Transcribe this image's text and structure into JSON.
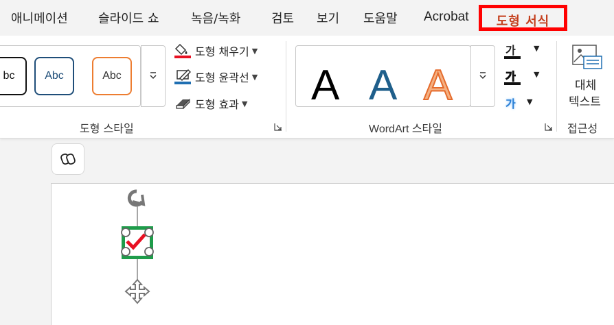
{
  "tabs": [
    {
      "label": "애니메이션"
    },
    {
      "label": "슬라이드 쇼"
    },
    {
      "label": "녹음/녹화"
    },
    {
      "label": "검토"
    },
    {
      "label": "보기"
    },
    {
      "label": "도움말"
    },
    {
      "label": "Acrobat"
    }
  ],
  "active_tab": {
    "label": "도형 서식"
  },
  "shape_styles": {
    "gallery": [
      {
        "text": "bc",
        "color": "#111111"
      },
      {
        "text": "Abc",
        "color": "#1f4e79"
      },
      {
        "text": "Abc",
        "color": "#ed7d31"
      }
    ],
    "commands": {
      "fill": "도형 채우기",
      "outline": "도형 윤곽선",
      "effects": "도형 효과"
    },
    "group_label": "도형 스타일"
  },
  "wordart": {
    "letters": [
      {
        "text": "A",
        "style": "black-fill"
      },
      {
        "text": "A",
        "style": "blue-fill"
      },
      {
        "text": "A",
        "style": "orange-outline"
      }
    ],
    "mini": {
      "text_fill": "가",
      "text_outline": "가",
      "text_effects": "가"
    },
    "group_label": "WordArt 스타일"
  },
  "accessibility": {
    "alt_text_line1": "대체",
    "alt_text_line2": "텍스트",
    "group_label": "접근성"
  },
  "colors": {
    "accent_red": "#ff0000",
    "active_tab_text": "#c43e1c",
    "fill_bar": "#e81123",
    "outline_bar": "#1f6fb2",
    "selection_green": "#1e9c4a",
    "check_red": "#e81123"
  }
}
